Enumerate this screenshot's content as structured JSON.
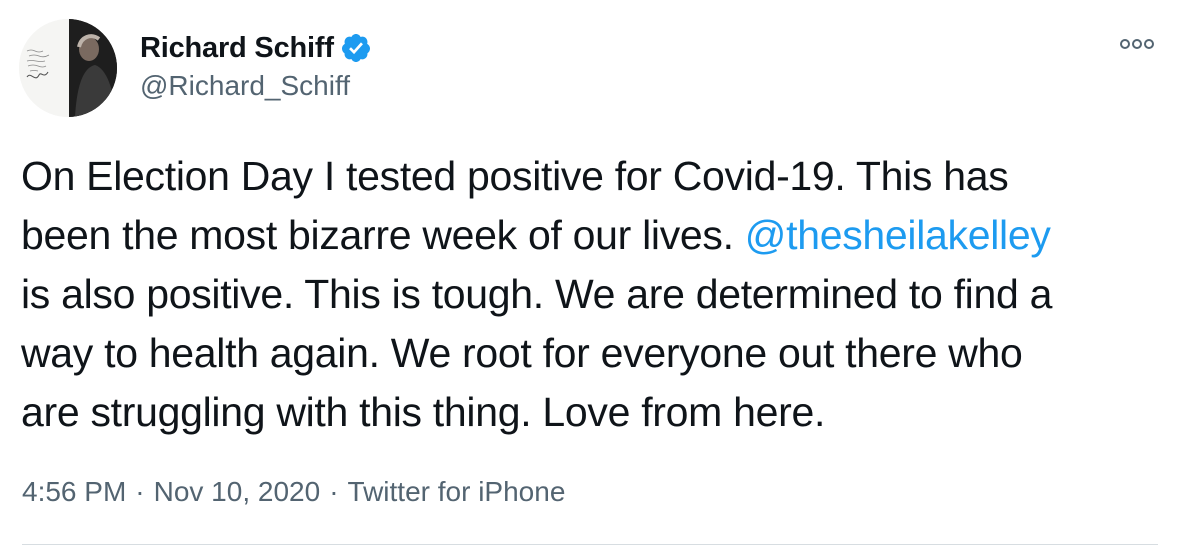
{
  "author": {
    "display_name": "Richard Schiff",
    "handle": "@Richard_Schiff",
    "verified": true
  },
  "tweet": {
    "lines": [
      {
        "before": "On Election Day I tested positive for Covid-19. This has",
        "mention": "",
        "after": ""
      },
      {
        "before": "been the most bizarre week of our lives. ",
        "mention": "@thesheilakelley",
        "after": ""
      },
      {
        "before": "is also positive. This is tough. We are determined to find a",
        "mention": "",
        "after": ""
      },
      {
        "before": "way to health again. We root for everyone out there who",
        "mention": "",
        "after": ""
      },
      {
        "before": "are struggling with this thing. Love from here.",
        "mention": "",
        "after": ""
      }
    ]
  },
  "meta": {
    "time": "4:56 PM",
    "separator": "·",
    "date": "Nov 10, 2020",
    "source": "Twitter for iPhone"
  },
  "colors": {
    "text": "#0f1419",
    "secondary": "#536471",
    "link": "#1d9bf0",
    "verified_badge": "#1d9bf0",
    "divider": "#d7dde1"
  },
  "icons": {
    "verified": "verified-badge-icon",
    "more": "more-options-icon"
  }
}
